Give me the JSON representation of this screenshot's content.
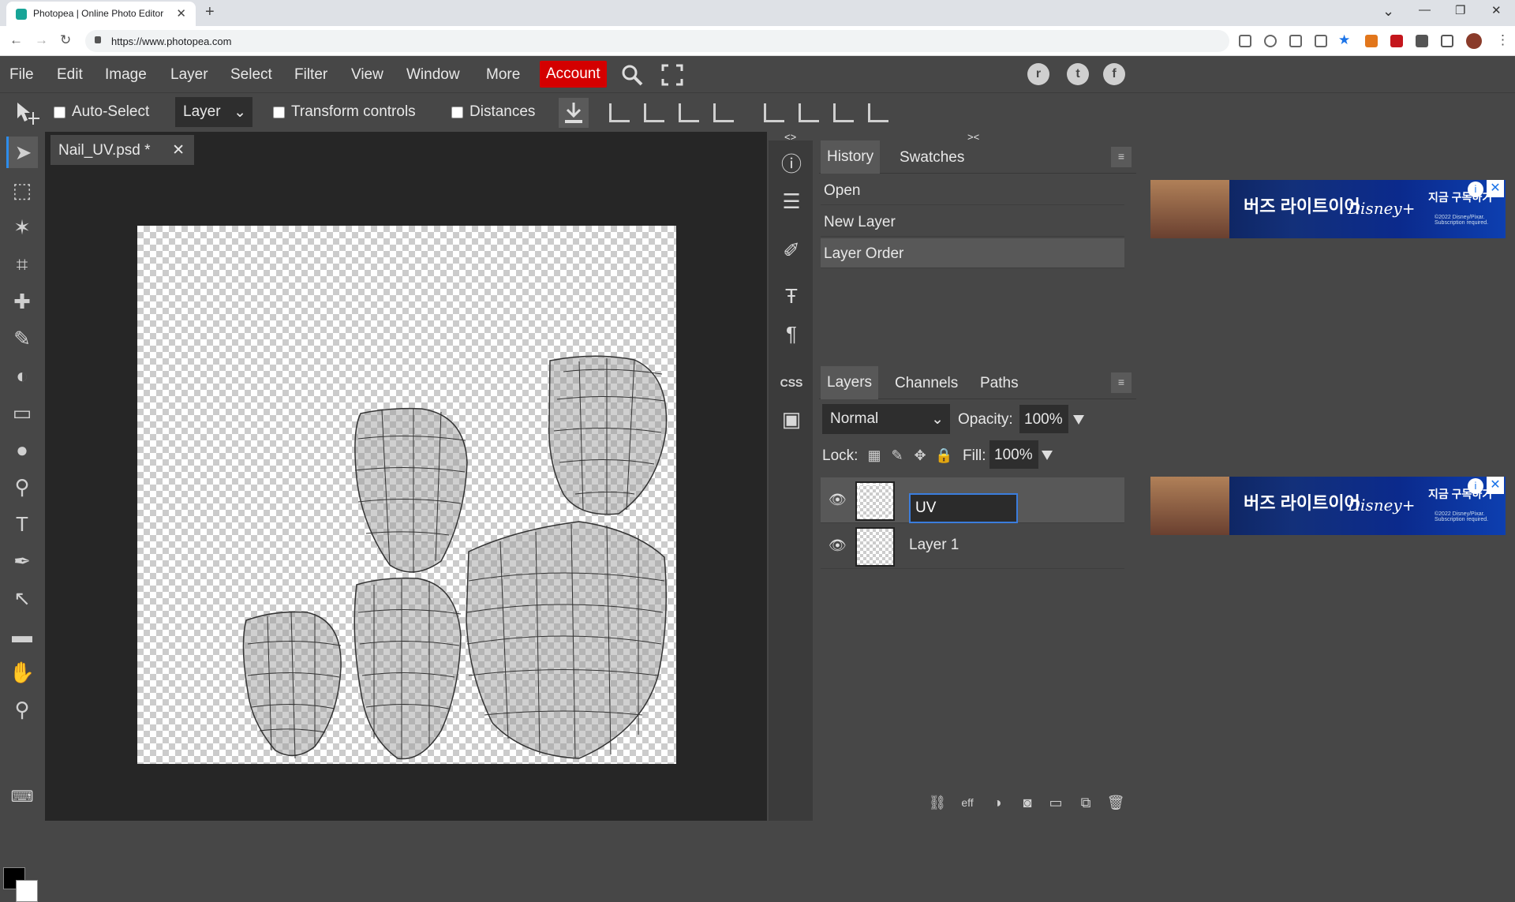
{
  "browser": {
    "tab_title": "Photopea | Online Photo Editor",
    "tab_close": "✕",
    "new_tab": "+",
    "url": "https://www.photopea.com",
    "window_controls": {
      "minimize": "—",
      "maximize": "❐",
      "close": "✕",
      "tab_list": "⌄"
    }
  },
  "menu": {
    "items": [
      "File",
      "Edit",
      "Image",
      "Layer",
      "Select",
      "Filter",
      "View",
      "Window",
      "More"
    ],
    "account": "Account",
    "account_color": "#d40000",
    "social": [
      "reddit-icon",
      "twitter-icon",
      "facebook-icon"
    ]
  },
  "options": {
    "auto_select": "Auto-Select",
    "layer_select": "Layer",
    "transform_controls": "Transform controls",
    "distances": "Distances"
  },
  "document": {
    "tab_title": "Nail_UV.psd *",
    "close": "✕"
  },
  "history": {
    "tabs": [
      "History",
      "Swatches"
    ],
    "items": [
      "Open",
      "New Layer",
      "Layer Order"
    ]
  },
  "layers": {
    "tabs": [
      "Layers",
      "Channels",
      "Paths"
    ],
    "blend_mode": "Normal",
    "opacity_label": "Opacity:",
    "opacity": "100%",
    "lock_label": "Lock:",
    "fill_label": "Fill:",
    "fill": "100%",
    "items": [
      {
        "name": "UV",
        "editing": true
      },
      {
        "name": "Layer 1",
        "editing": false
      }
    ]
  },
  "ads": [
    {
      "title": "버즈 라이트이어",
      "brand": "Disney+",
      "cta": "지금 구독하기",
      "fine": "©2022 Disney/Pixar. Subscription required."
    },
    {
      "title": "버즈 라이트이어",
      "brand": "Disney+",
      "cta": "지금 구독하기",
      "fine": "©2022 Disney/Pixar. Subscription required."
    }
  ],
  "colors": {
    "accent": "#2d8ceb",
    "foreground": "#000000",
    "background": "#ffffff"
  }
}
